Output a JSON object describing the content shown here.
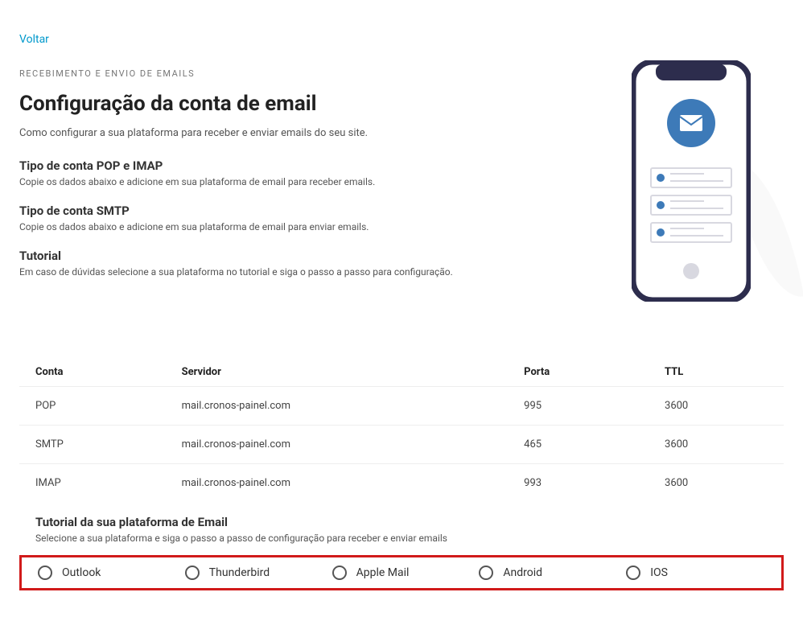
{
  "back": "Voltar",
  "section_label": "RECEBIMENTO E ENVIO DE EMAILS",
  "title": "Configuração da conta de email",
  "subtitle": "Como configurar a sua plataforma para receber e enviar emails do seu site.",
  "block1": {
    "title": "Tipo de conta POP e IMAP",
    "desc": "Copie os dados abaixo e adicione em sua plataforma de email para receber emails."
  },
  "block2": {
    "title": "Tipo de conta SMTP",
    "desc": "Copie os dados abaixo e adicione em sua plataforma de email para enviar emails."
  },
  "block3": {
    "title": "Tutorial",
    "desc": "Em caso de dúvidas selecione a sua plataforma no tutorial e siga o passo a passo para configuração."
  },
  "table": {
    "headers": {
      "conta": "Conta",
      "servidor": "Servidor",
      "porta": "Porta",
      "ttl": "TTL"
    },
    "rows": [
      {
        "conta": "POP",
        "servidor": "mail.cronos-painel.com",
        "porta": "995",
        "ttl": "3600"
      },
      {
        "conta": "SMTP",
        "servidor": "mail.cronos-painel.com",
        "porta": "465",
        "ttl": "3600"
      },
      {
        "conta": "IMAP",
        "servidor": "mail.cronos-painel.com",
        "porta": "993",
        "ttl": "3600"
      }
    ]
  },
  "tutorial": {
    "title": "Tutorial da sua plataforma de Email",
    "subtitle": "Selecione a sua plataforma e siga o passo a passo de configuração para receber e enviar emails",
    "options": {
      "outlook": "Outlook",
      "thunderbird": "Thunderbird",
      "applemail": "Apple Mail",
      "android": "Android",
      "ios": "IOS"
    }
  }
}
